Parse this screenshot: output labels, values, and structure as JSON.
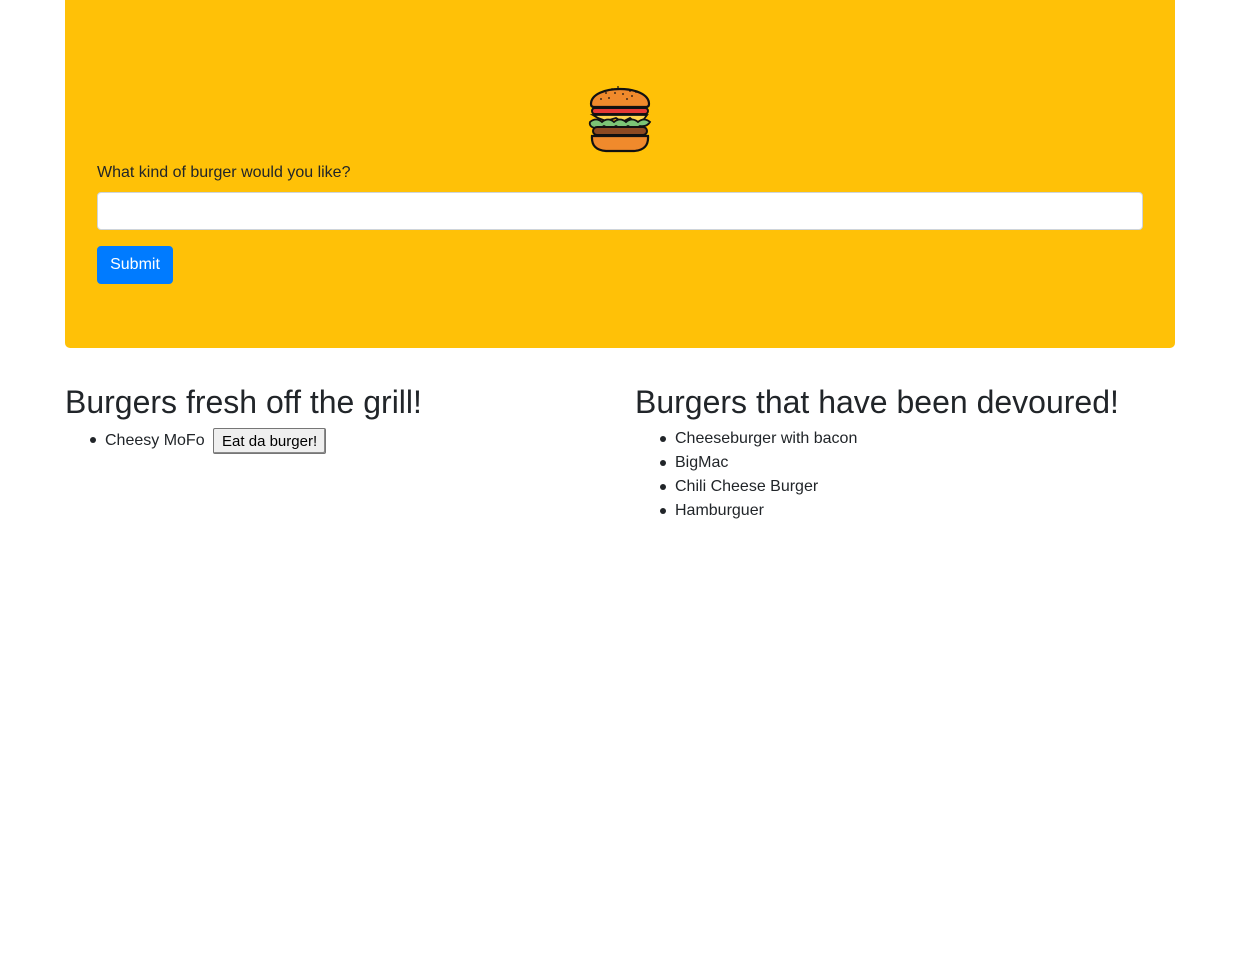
{
  "header": {
    "logo_icon": "hamburger-icon",
    "form_label": "What kind of burger would you like?",
    "input_value": "",
    "submit_label": "Submit",
    "accent_color": "#ffc107",
    "button_color": "#007bff"
  },
  "fresh": {
    "heading": "Burgers fresh off the grill!",
    "items": [
      {
        "name": "Cheesy MoFo",
        "button_label": "Eat da burger!"
      }
    ]
  },
  "devoured": {
    "heading": "Burgers that have been devoured!",
    "items": [
      {
        "name": "Cheeseburger with bacon"
      },
      {
        "name": "BigMac"
      },
      {
        "name": "Chili Cheese Burger"
      },
      {
        "name": "Hamburguer"
      }
    ]
  }
}
